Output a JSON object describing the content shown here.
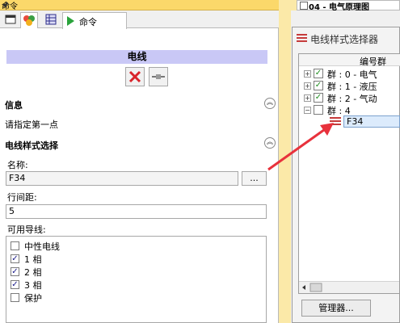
{
  "left_panel": {
    "title": "命令",
    "pin": "🖈",
    "tab_cmd_label": "命令",
    "cmd_header": "电线",
    "section_info": "信息",
    "info_text": "请指定第一点",
    "section_style": "电线样式选择",
    "name_label": "名称:",
    "name_value": "F34",
    "browse_label": "...",
    "spacing_label": "行间距:",
    "spacing_value": "5",
    "available_label": "可用导线:",
    "lines": [
      {
        "label": "中性电线",
        "checked": false
      },
      {
        "label": "1 相",
        "checked": true
      },
      {
        "label": "2 相",
        "checked": true
      },
      {
        "label": "3 相",
        "checked": true
      },
      {
        "label": "保护",
        "checked": false
      }
    ]
  },
  "right_panel": {
    "doc_tab": "04 - 电气原理图",
    "selector_title": "电线样式选择器",
    "tree_header": "编号群",
    "groups": [
      {
        "label": "群 : 0 - 电气",
        "checked": true
      },
      {
        "label": "群 : 1 - 液压",
        "checked": true
      },
      {
        "label": "群 : 2 - 气动",
        "checked": true
      },
      {
        "label": "群 : 4",
        "checked": false
      }
    ],
    "selected_item": "F34",
    "manager_button": "管理器..."
  },
  "colors": {
    "header_bar": "#c9c8f6",
    "title_bar": "#fbd86a",
    "arrow": "#e8323c",
    "selection": "#dcebfc"
  }
}
